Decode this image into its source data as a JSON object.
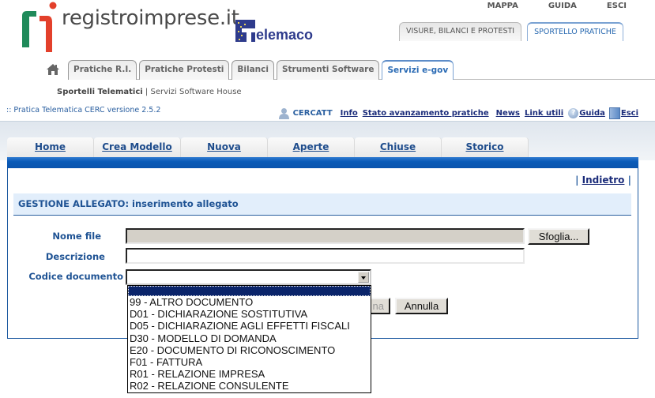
{
  "brand": {
    "logo_text": "registroimprese.it",
    "partner_logo_text": "elemaco"
  },
  "top_links": [
    "MAPPA",
    "GUIDA",
    "ESCI"
  ],
  "portal_tabs": [
    {
      "label": "VISURE, BILANCI E PROTESTI",
      "active": false
    },
    {
      "label": "SPORTELLO PRATICHE",
      "active": true
    }
  ],
  "main_tabs": [
    {
      "label": "Pratiche R.I.",
      "active": false
    },
    {
      "label": "Pratiche Protesti",
      "active": false
    },
    {
      "label": "Bilanci",
      "active": false
    },
    {
      "label": "Strumenti Software",
      "active": false
    },
    {
      "label": "Servizi e-gov",
      "active": true
    }
  ],
  "subnav": {
    "current": "Sportelli Telematici",
    "separator": "|",
    "other": "Servizi Software House"
  },
  "cerc": {
    "title": ":: Pratica Telematica CERC versione 2.5.2",
    "user": "CERCATT",
    "links": {
      "info": "Info",
      "stato": "Stato avanzamento pratiche",
      "news": "News",
      "link_utili": "Link utili",
      "guida": "Guida",
      "esci": "Esci"
    }
  },
  "nav_tabs": [
    "Home",
    "Crea Modello",
    "Nuova",
    "Aperte",
    "Chiuse",
    "Storico"
  ],
  "indietro": {
    "prefix": "|",
    "label": "Indietro",
    "suffix": "|"
  },
  "section_title": "GESTIONE ALLEGATO: inserimento allegato",
  "form": {
    "nome_file_label": "Nome file",
    "nome_file_value": "",
    "browse_label": "Sfoglia...",
    "descrizione_label": "Descrizione",
    "descrizione_value": "",
    "codice_label": "Codice documento",
    "codice_value": "",
    "confirm_partial": "na",
    "annulla_label": "Annulla"
  },
  "dropdown_options": [
    "",
    "99 - ALTRO DOCUMENTO",
    "D01 - DICHIARAZIONE SOSTITUTIVA",
    "D05 - DICHIARAZIONE AGLI EFFETTI FISCALI",
    "D30 - MODELLO DI DOMANDA",
    "E20 - DOCUMENTO DI RICONOSCIMENTO",
    "F01 - FATTURA",
    "R01 - RELAZIONE IMPRESA",
    "R02 - RELAZIONE CONSULENTE"
  ],
  "colors": {
    "brand_blue": "#1f5394",
    "nav_bar": "#0a5bb8",
    "link_dark": "#1b2c7a",
    "logo_green": "#1f8a5a",
    "logo_red": "#e3402b"
  }
}
